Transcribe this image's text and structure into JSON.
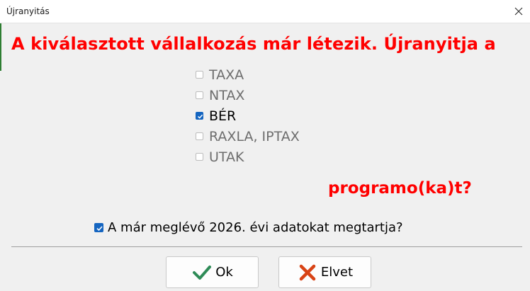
{
  "window": {
    "title": "Újranyitás",
    "close_icon": "close-icon"
  },
  "message": {
    "heading": "A kiválasztott vállalkozás már létezik. Újranyitja a",
    "suffix": "programo(ka)t?"
  },
  "modules": [
    {
      "label": "TAXA",
      "checked": false
    },
    {
      "label": "NTAX",
      "checked": false
    },
    {
      "label": "BÉR",
      "checked": true
    },
    {
      "label": "RAXLA, IPTAX",
      "checked": false
    },
    {
      "label": "UTAK",
      "checked": false
    }
  ],
  "keep_data": {
    "label": "A már meglévő 2026. évi adatokat megtartja?",
    "checked": true
  },
  "buttons": {
    "ok_label": "Ok",
    "ok_icon": "checkmark-icon",
    "cancel_label": "Elvet",
    "cancel_icon": "x-mark-icon"
  },
  "colors": {
    "heading": "#ff0000",
    "checkbox_checked": "#1565c0",
    "ok_icon": "#2e8b57",
    "cancel_icon": "#d84315",
    "disabled_text": "#6d6d6d"
  }
}
